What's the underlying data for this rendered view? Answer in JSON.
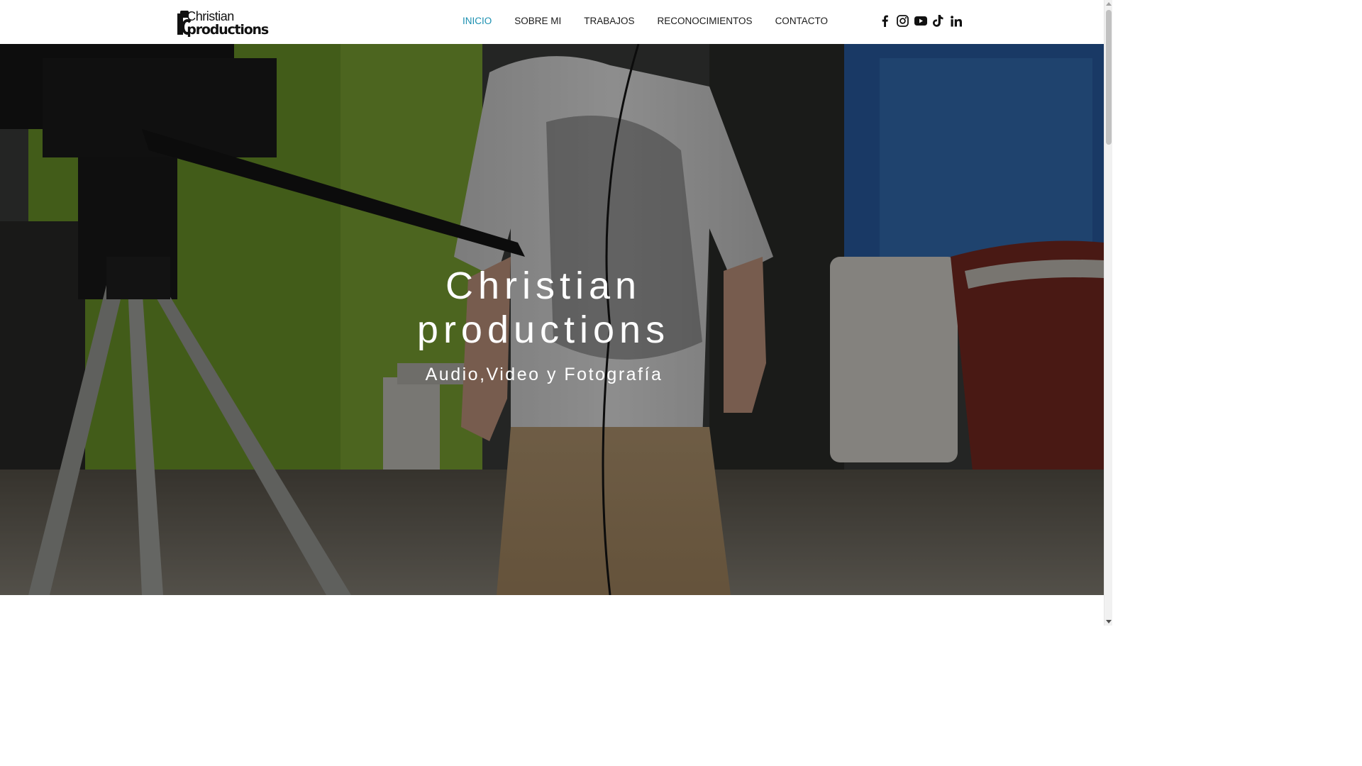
{
  "header": {
    "logo": {
      "line1": "Christian",
      "line2": "productions"
    },
    "nav": [
      {
        "label": "INICIO",
        "active": true
      },
      {
        "label": "SOBRE MI",
        "active": false
      },
      {
        "label": "TRABAJOS",
        "active": false
      },
      {
        "label": "RECONOCIMIENTOS",
        "active": false
      },
      {
        "label": "CONTACTO",
        "active": false
      }
    ],
    "social": [
      "facebook-icon",
      "instagram-icon",
      "youtube-icon",
      "tiktok-icon",
      "linkedin-icon"
    ]
  },
  "hero": {
    "title_line1": "Christian",
    "title_line2": "productions",
    "subtitle": "Audio,Video y Fotografía"
  },
  "colors": {
    "active_nav": "#1a8fb0",
    "text": "#1a1a1a",
    "hero_text": "#ffffff"
  }
}
